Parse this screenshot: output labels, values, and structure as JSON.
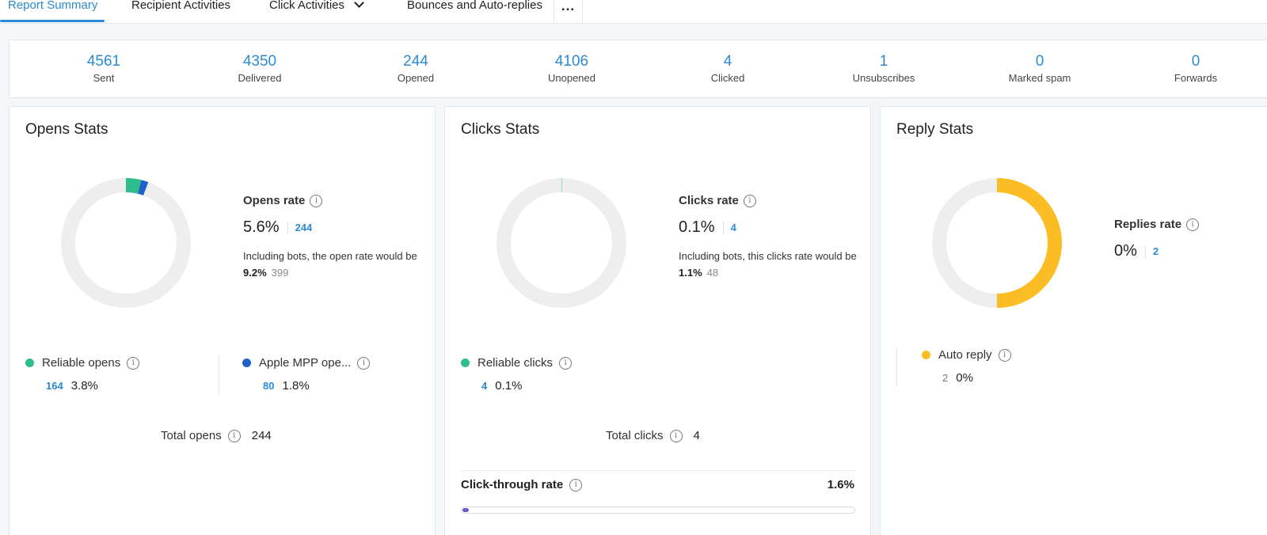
{
  "tabs": [
    {
      "label": "Report Summary",
      "active": true
    },
    {
      "label": "Recipient Activities"
    },
    {
      "label": "Click Activities"
    },
    {
      "label": "Bounces and Auto-replies"
    }
  ],
  "more_label": "...",
  "summary": [
    {
      "value": "4561",
      "label": "Sent"
    },
    {
      "value": "4350",
      "label": "Delivered"
    },
    {
      "value": "244",
      "label": "Opened"
    },
    {
      "value": "4106",
      "label": "Unopened"
    },
    {
      "value": "4",
      "label": "Clicked"
    },
    {
      "value": "1",
      "label": "Unsubscribes"
    },
    {
      "value": "0",
      "label": "Marked spam"
    },
    {
      "value": "0",
      "label": "Forwards"
    }
  ],
  "colors": {
    "accent": "#2a8ad4",
    "reliable": "#2dbd8a",
    "apple_mpp": "#1f63c9",
    "auto_reply": "#fbbd23",
    "ring_bg": "#eeeeee",
    "ctr_fill": "#6a5ad1"
  },
  "opens": {
    "title": "Opens Stats",
    "rate_label": "Opens rate",
    "rate": "5.6%",
    "count": "244",
    "note_prefix": "Including bots, the open rate would be",
    "note_rate": "9.2%",
    "note_count": "399",
    "donut": {
      "reliable_pct": 3.8,
      "apple_pct": 1.8
    },
    "reliable": {
      "label": "Reliable opens",
      "count": "164",
      "pct": "3.8%"
    },
    "apple": {
      "label": "Apple MPP ope...",
      "count": "80",
      "pct": "1.8%"
    },
    "total_label": "Total opens",
    "total": "244"
  },
  "clicks": {
    "title": "Clicks Stats",
    "rate_label": "Clicks rate",
    "rate": "0.1%",
    "count": "4",
    "note_prefix": "Including bots, this clicks rate would be",
    "note_rate": "1.1%",
    "note_count": "48",
    "donut": {
      "reliable_pct": 0.1
    },
    "reliable": {
      "label": "Reliable clicks",
      "count": "4",
      "pct": "0.1%"
    },
    "total_label": "Total clicks",
    "total": "4",
    "ctr_label": "Click-through rate",
    "ctr": "1.6%",
    "ctr_fraction": 0.016
  },
  "replies": {
    "title": "Reply Stats",
    "rate_label": "Replies rate",
    "rate": "0%",
    "count": "2",
    "donut": {
      "reply_share": 0.5
    },
    "auto": {
      "label": "Auto reply",
      "count": "2",
      "pct": "0%"
    }
  }
}
